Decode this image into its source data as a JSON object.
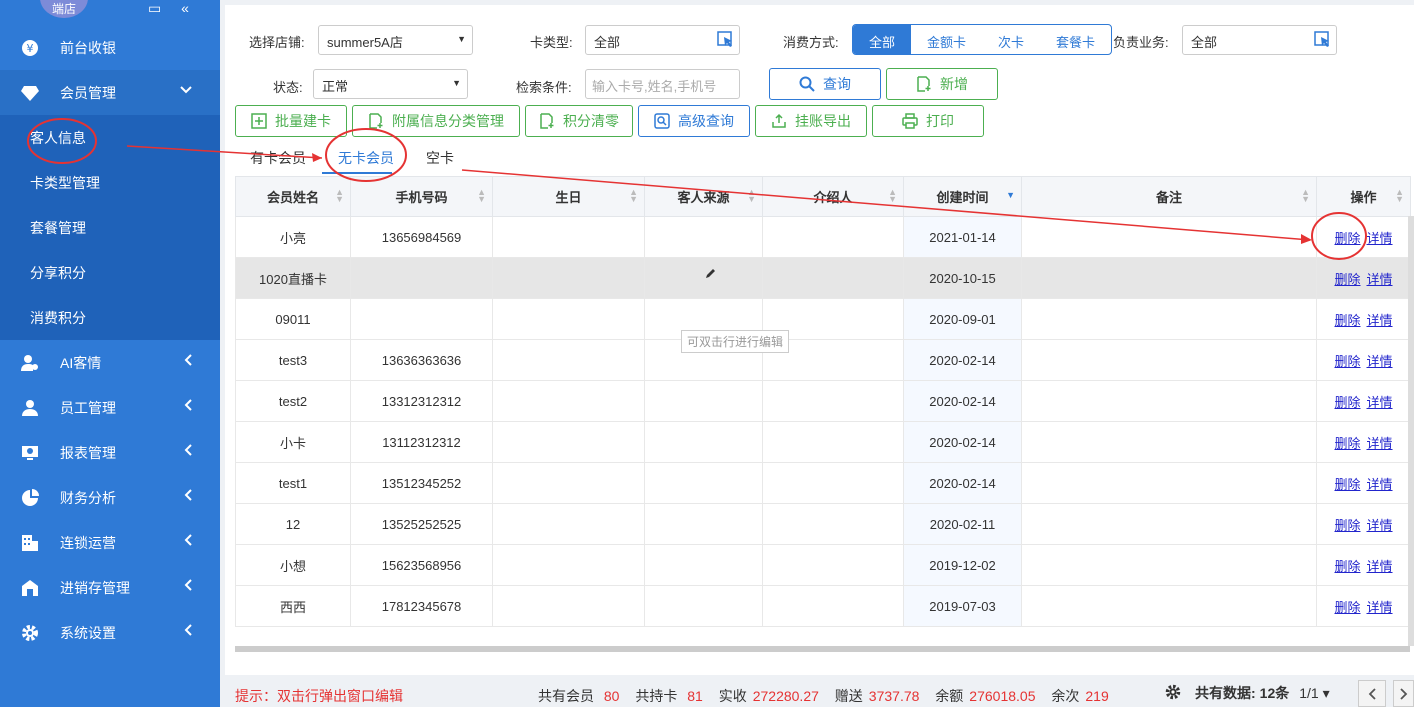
{
  "sidebar": {
    "logo_text": "端店",
    "items": [
      {
        "label": "前台收银"
      },
      {
        "label": "会员管理"
      },
      {
        "label": "AI客情"
      },
      {
        "label": "员工管理"
      },
      {
        "label": "报表管理"
      },
      {
        "label": "财务分析"
      },
      {
        "label": "连锁运营"
      },
      {
        "label": "进销存管理"
      },
      {
        "label": "系统设置"
      }
    ],
    "sub_items": [
      {
        "label": "客人信息"
      },
      {
        "label": "卡类型管理"
      },
      {
        "label": "套餐管理"
      },
      {
        "label": "分享积分"
      },
      {
        "label": "消费积分"
      }
    ]
  },
  "filters": {
    "store_label": "选择店铺:",
    "store_value": "summer5A店",
    "card_type_label": "卡类型:",
    "card_type_value": "全部",
    "pay_mode_label": "消费方式:",
    "pay_modes": [
      "全部",
      "金额卡",
      "次卡",
      "套餐卡"
    ],
    "owner_label": "负责业务:",
    "owner_value": "全部",
    "status_label": "状态:",
    "status_value": "正常",
    "search_label": "检索条件:",
    "search_placeholder": "输入卡号,姓名,手机号",
    "query_label": "查询",
    "add_label": "新增"
  },
  "actions": {
    "batch_card": "批量建卡",
    "attach_category": "附属信息分类管理",
    "points_clear": "积分清零",
    "advanced_query": "高级查询",
    "export_debt": "挂账导出",
    "print": "打印"
  },
  "tabs": [
    "有卡会员",
    "无卡会员",
    "空卡"
  ],
  "table": {
    "headers": [
      "会员姓名",
      "手机号码",
      "生日",
      "客人来源",
      "介绍人",
      "创建时间",
      "备注",
      "操作"
    ],
    "delete_label": "删除",
    "detail_label": "详情",
    "rows": [
      {
        "name": "小亮",
        "phone": "13656984569",
        "date": "2021-01-14"
      },
      {
        "name": "1020直播卡",
        "phone": "",
        "date": "2020-10-15"
      },
      {
        "name": "09011",
        "phone": "",
        "date": "2020-09-01"
      },
      {
        "name": "test3",
        "phone": "13636363636",
        "date": "2020-02-14"
      },
      {
        "name": "test2",
        "phone": "13312312312",
        "date": "2020-02-14"
      },
      {
        "name": "小卡",
        "phone": "13112312312",
        "date": "2020-02-14"
      },
      {
        "name": "test1",
        "phone": "13512345252",
        "date": "2020-02-14"
      },
      {
        "name": "12",
        "phone": "13525252525",
        "date": "2020-02-11"
      },
      {
        "name": "小想",
        "phone": "15623568956",
        "date": "2019-12-02"
      },
      {
        "name": "西西",
        "phone": "17812345678",
        "date": "2019-07-03"
      }
    ],
    "tooltip": "可双击行进行编辑"
  },
  "footer": {
    "hint": "提示：双击行弹出窗口编辑",
    "members_label": "共有会员",
    "members_value": "80",
    "cards_label": "共持卡",
    "cards_value": "81",
    "received_label": "实收",
    "received_value": "272280.27",
    "gift_label": "赠送",
    "gift_value": "3737.78",
    "balance_label": "余额",
    "balance_value": "276018.05",
    "remaining_label": "余次",
    "remaining_value": "219",
    "total_label": "共有数据:",
    "total_value": "12条",
    "page_value": "1/1"
  },
  "colors": {
    "sidebar": "#2f7ad6",
    "accent": "#2f7ad6",
    "green": "#4caf50",
    "annotation": "#e53333"
  }
}
